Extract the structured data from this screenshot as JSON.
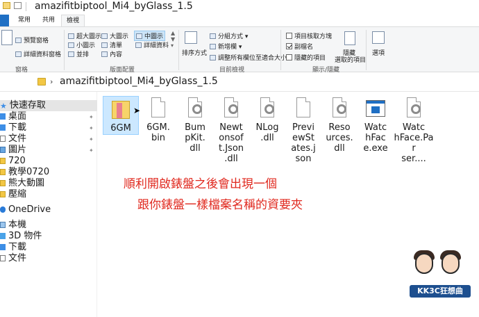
{
  "window": {
    "title": "amazifitbiptool_Mi4_byGlass_1.5"
  },
  "tabs": [
    "常用",
    "共用",
    "檢視"
  ],
  "ribbon": {
    "pane": {
      "preview": "預覽窗格",
      "details": "詳細資料窗格",
      "group": "窗格"
    },
    "layout": {
      "items": [
        "超大圖示",
        "大圖示",
        "中圖示",
        "小圖示",
        "清單",
        "詳細資料",
        "並排",
        "內容"
      ],
      "group": "版面配置"
    },
    "current_view": {
      "sort": "排序方式",
      "group_by": "分組方式",
      "add_column": "新增欄",
      "fit_columns": "調整所有欄位至適合大小",
      "group": "目前檢視"
    },
    "show_hide": {
      "item_checkbox": "項目核取方塊",
      "extensions": "副檔名",
      "hidden_items": "隱藏的項目",
      "hide_selected_line1": "隱藏",
      "hide_selected_line2": "選取的項目",
      "group": "顯示/隱藏"
    },
    "options": "選項"
  },
  "address": {
    "path": "amazifitbiptool_Mi4_byGlass_1.5"
  },
  "nav": {
    "items": [
      "快速存取",
      "桌面",
      "下載",
      "文件",
      "圖片",
      "720",
      "教學0720",
      "熊大動圖",
      "壓縮",
      "OneDrive",
      "本機",
      "3D 物件",
      "下載",
      "文件"
    ]
  },
  "files": [
    "6GM",
    "6GM.\nbin",
    "Bum\npKit.\ndll",
    "Newt\nonsof\nt.Json\n.dll",
    "NLog\n.dll",
    "Previ\newSt\nates.j\nson",
    "Reso\nurces.\ndll",
    "Watc\nhFac\ne.exe",
    "Watc\nhFace.Par\nser...."
  ],
  "annotation": {
    "line1": "順利開啟錶盤之後會出現一個",
    "line2": "跟你錶盤一樣檔案名稱的資要夾"
  },
  "logo": {
    "text": "KK3C狂想曲"
  }
}
